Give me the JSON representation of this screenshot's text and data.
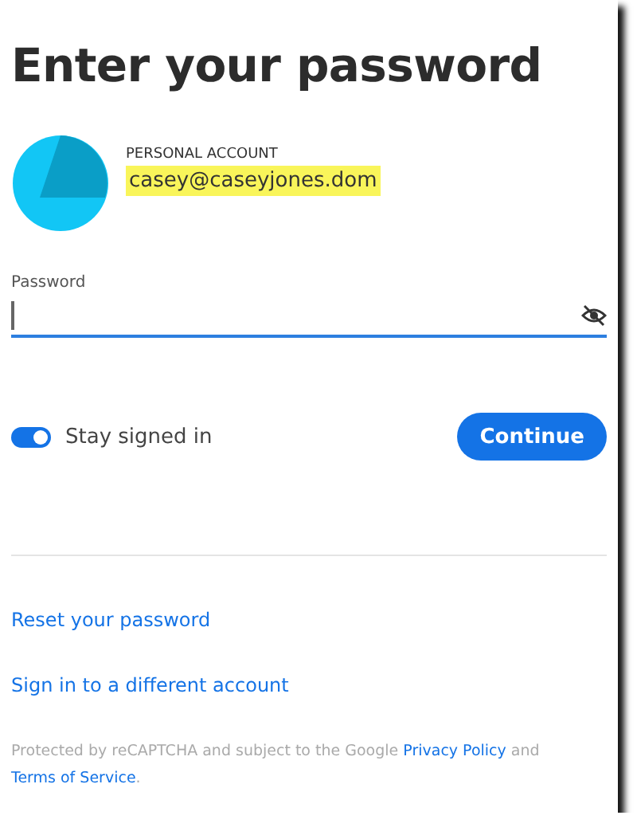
{
  "title": "Enter your password",
  "account": {
    "type": "PERSONAL ACCOUNT",
    "email": "casey@caseyjones.dom",
    "highlighted": true
  },
  "password": {
    "label": "Password",
    "focused": true
  },
  "stay_signed_in": {
    "label": "Stay signed in",
    "on": true
  },
  "continue_button": "Continue",
  "links": [
    "Reset your password",
    "Sign in to a different account"
  ],
  "footer": [
    {
      "kind": "text",
      "text": "Protected by reCAPTCHA and subject to the Google "
    },
    {
      "kind": "link",
      "text": "Privacy Policy"
    },
    {
      "kind": "text",
      "text": " and "
    },
    {
      "kind": "link",
      "text": "Terms of Service"
    },
    {
      "kind": "text",
      "text": "."
    }
  ]
}
